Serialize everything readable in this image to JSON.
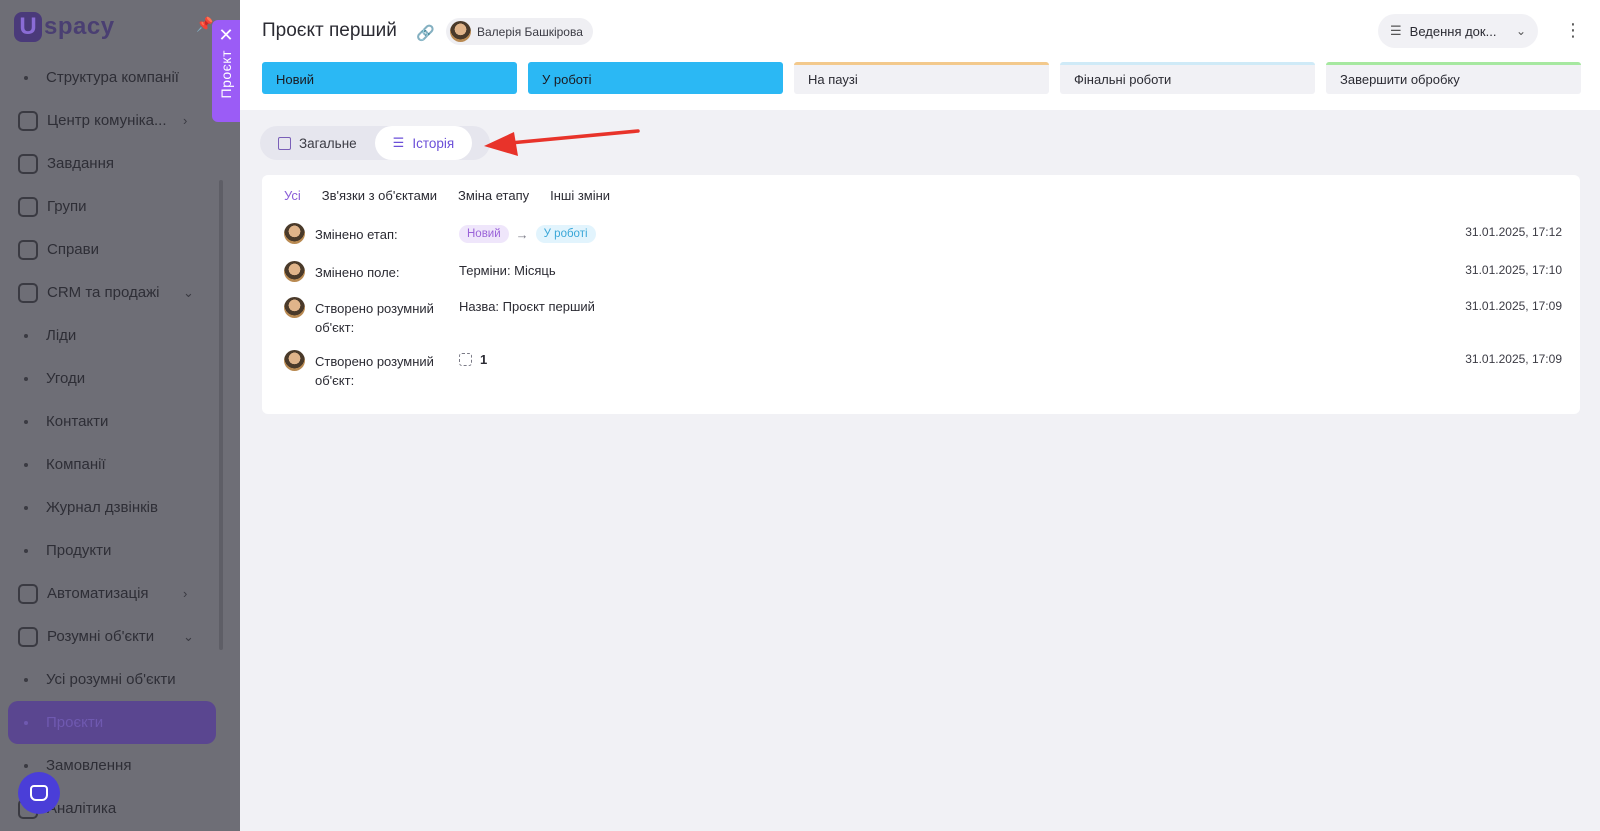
{
  "sidebar": {
    "logo_text": "spacy",
    "items": [
      {
        "label": "Структура компанії",
        "kind": "sub"
      },
      {
        "label": "Центр комуніка...",
        "kind": "top",
        "chevron": "›"
      },
      {
        "label": "Завдання",
        "kind": "top"
      },
      {
        "label": "Групи",
        "kind": "top"
      },
      {
        "label": "Справи",
        "kind": "top"
      },
      {
        "label": "CRM та продажі",
        "kind": "top",
        "chevron": "⌄"
      },
      {
        "label": "Ліди",
        "kind": "sub"
      },
      {
        "label": "Угоди",
        "kind": "sub"
      },
      {
        "label": "Контакти",
        "kind": "sub"
      },
      {
        "label": "Компанії",
        "kind": "sub"
      },
      {
        "label": "Журнал дзвінків",
        "kind": "sub"
      },
      {
        "label": "Продукти",
        "kind": "sub"
      },
      {
        "label": "Автоматизація",
        "kind": "top",
        "chevron": "›"
      },
      {
        "label": "Розумні об'єкти",
        "kind": "top",
        "chevron": "⌄"
      },
      {
        "label": "Усі розумні об'єкти",
        "kind": "sub"
      },
      {
        "label": "Проєкти",
        "kind": "sub",
        "active": true
      },
      {
        "label": "Замовлення",
        "kind": "sub"
      },
      {
        "label": "Аналітика",
        "kind": "top"
      }
    ]
  },
  "panel_tab": {
    "label": "Проєкт",
    "close": "✕"
  },
  "header": {
    "title": "Проєкт перший",
    "user_name": "Валерія Башкірова",
    "process_select": "Ведення док...",
    "more": "⋮"
  },
  "stages": [
    {
      "label": "Новий",
      "active": true,
      "color": "#2bb8f4"
    },
    {
      "label": "У роботі",
      "active": true,
      "color": "#2bb8f4"
    },
    {
      "label": "На паузі",
      "active": false,
      "color": "#f3c98c"
    },
    {
      "label": "Фінальні роботи",
      "active": false,
      "color": "#cfeaf7"
    },
    {
      "label": "Завершити обробку",
      "active": false,
      "color": "#a6e8a0"
    }
  ],
  "tabs": {
    "general": "Загальне",
    "history": "Історія"
  },
  "history": {
    "filters": [
      "Усі",
      "Зв'язки з об'єктами",
      "Зміна етапу",
      "Інші зміни"
    ],
    "rows": [
      {
        "label": "Змінено етап:",
        "type": "stage",
        "from": "Новий",
        "to": "У роботі",
        "time": "31.01.2025, 17:12"
      },
      {
        "label": "Змінено поле:",
        "type": "text",
        "value": "Терміни: Місяць",
        "time": "31.01.2025, 17:10"
      },
      {
        "label": "Створено розумний об'єкт:",
        "type": "text",
        "value": "Назва:  Проєкт перший",
        "time": "31.01.2025, 17:09"
      },
      {
        "label": "Створено розумний об'єкт:",
        "type": "object",
        "value": "1",
        "time": "31.01.2025, 17:09"
      }
    ]
  },
  "colors": {
    "accent": "#9b5cf6",
    "stage_active": "#2bb8f4",
    "annotation_arrow": "#e8332a"
  }
}
